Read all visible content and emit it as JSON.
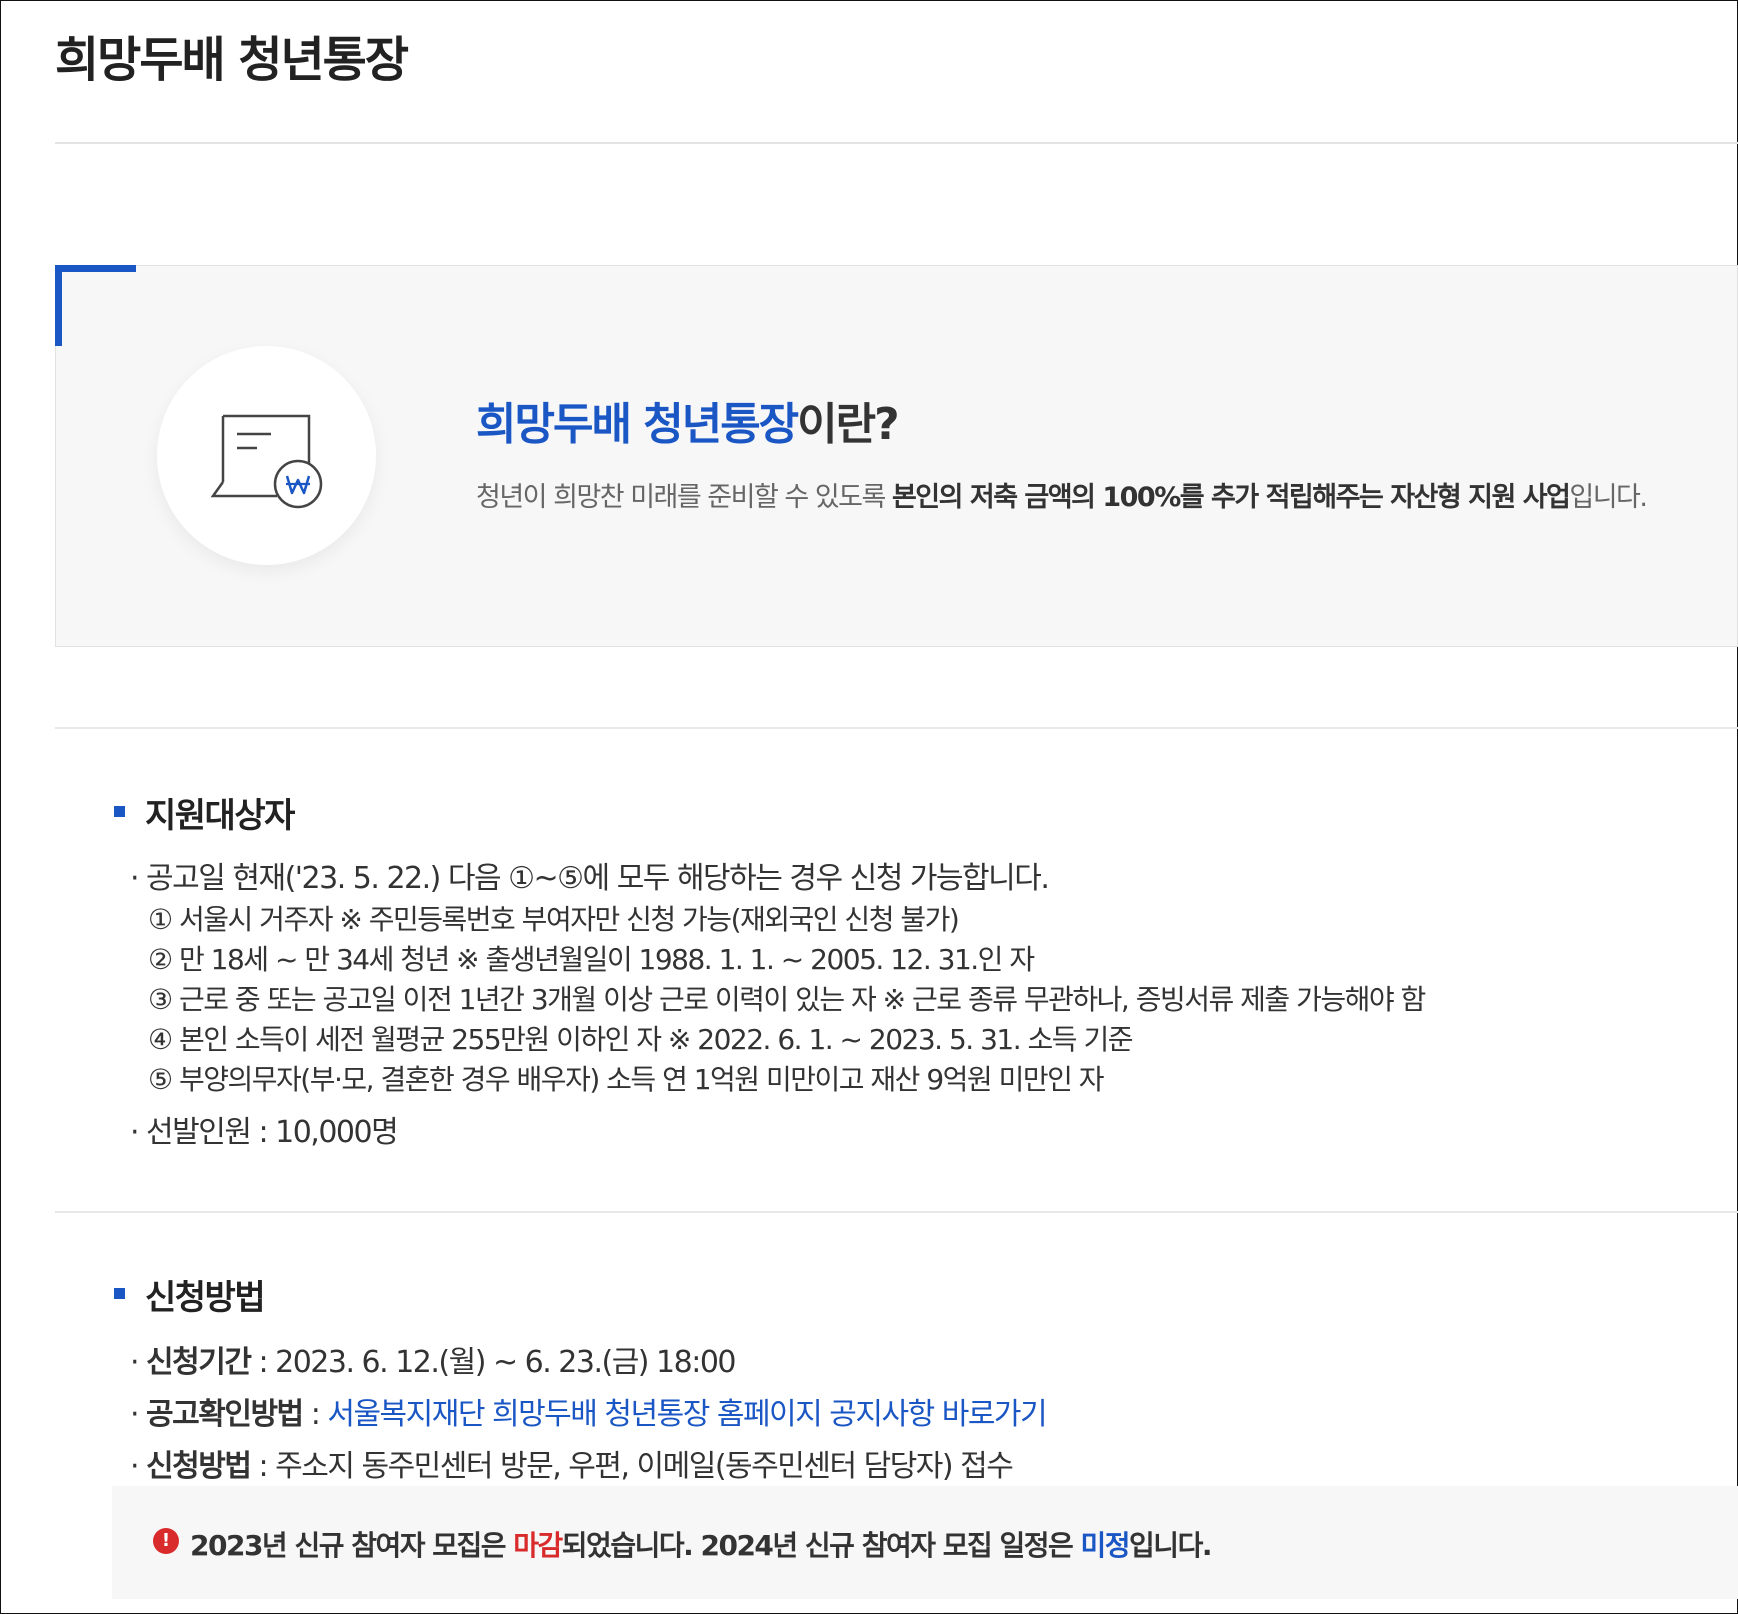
{
  "page": {
    "title": "희망두배 청년통장"
  },
  "intro": {
    "title_highlight": "희망두배 청년통장",
    "title_suffix": "이란?",
    "desc_prefix": "청년이 희망찬 미래를 준비할 수 있도록 ",
    "desc_bold": "본인의 저축 금액의 100%를 추가 적립해주는 자산형 지원 사업",
    "desc_suffix": "입니다.",
    "icon": "document-won-icon",
    "accent_color": "#1a56c4"
  },
  "eligibility": {
    "heading": "지원대상자",
    "lead": "공고일 현재('23. 5. 22.) 다음 ①~⑤에 모두 해당하는 경우 신청 가능합니다.",
    "items": [
      "① 서울시 거주자 ※ 주민등록번호 부여자만 신청 가능(재외국인 신청 불가)",
      "② 만 18세 ~ 만 34세 청년 ※ 출생년월일이 1988. 1. 1. ~ 2005. 12. 31.인 자",
      "③ 근로 중 또는 공고일 이전 1년간 3개월 이상 근로 이력이 있는 자 ※ 근로 종류 무관하나, 증빙서류 제출 가능해야 함",
      "④ 본인 소득이 세전 월평균 255만원 이하인 자 ※ 2022. 6. 1. ~ 2023. 5. 31. 소득 기준",
      "⑤ 부양의무자(부·모, 결혼한 경우 배우자) 소득 연 1억원 미만이고 재산 9억원 미만인 자"
    ],
    "selection": "선발인원 : 10,000명"
  },
  "apply": {
    "heading": "신청방법",
    "period_label": "신청기간",
    "period_value": " : 2023. 6. 12.(월) ~ 6. 23.(금) 18:00",
    "notice_label": "공고확인방법",
    "notice_sep": " : ",
    "notice_link": "서울복지재단 희망두배 청년통장 홈페이지 공지사항 바로가기",
    "method_label": "신청방법",
    "method_value": " : 주소지 동주민센터 방문, 우편, 이메일(동주민센터 담당자) 접수"
  },
  "alert": {
    "icon": "exclamation-icon",
    "part1": "2023년 신규 참여자 모집은 ",
    "closed": "마감",
    "part2": "되었습니다. 2024년 신규 참여자 모집 일정은 ",
    "undecided": "미정",
    "part3": "입니다.",
    "closed_color": "#d92b2b",
    "undecided_color": "#1a56c4"
  }
}
